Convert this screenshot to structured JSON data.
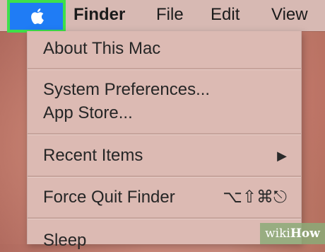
{
  "menubar": {
    "apple_menu": {
      "icon": "apple-logo-icon",
      "highlight_color": "#1f7cf5",
      "outline_color": "#3ee04a"
    },
    "items": [
      {
        "label": "Finder"
      },
      {
        "label": "File"
      },
      {
        "label": "Edit"
      },
      {
        "label": "View"
      }
    ]
  },
  "apple_menu": {
    "items": [
      {
        "label": "About This Mac"
      },
      {
        "label": "System Preferences..."
      },
      {
        "label": "App Store..."
      },
      {
        "label": "Recent Items",
        "submenu_indicator": "▶"
      },
      {
        "label": "Force Quit Finder",
        "shortcut": "⌥⇧⌘⎋"
      },
      {
        "label": "Sleep"
      }
    ]
  },
  "watermark": {
    "prefix": "wiki",
    "suffix": "How"
  }
}
